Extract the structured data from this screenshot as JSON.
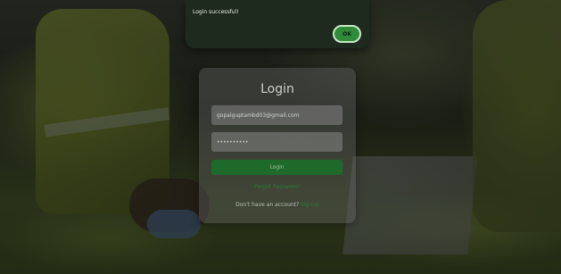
{
  "alert": {
    "message": "Login successful!",
    "ok_label": "OK"
  },
  "login": {
    "title": "Login",
    "email_value": "gopalguptambd03@gmail.com",
    "password_value": "••••••••••",
    "button_label": "Login",
    "forgot_label": "Forgot Password?",
    "no_account_text": "Don't have an account? ",
    "signup_label": "Signup"
  },
  "colors": {
    "accent_green": "#1e6a2b",
    "link_green": "#2f7a35"
  }
}
